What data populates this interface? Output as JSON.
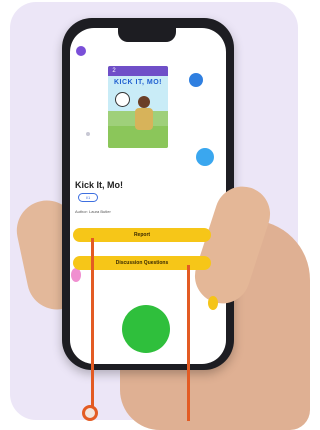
{
  "book": {
    "cover_number": "2",
    "cover_title": "KICK IT, MO!",
    "title": "Kick It, Mo!",
    "level_badge": "I/1",
    "author_line": "Author: Laura Butler"
  },
  "actions": {
    "report_label": "Report",
    "discussion_label": "Discussion Questions"
  },
  "colors": {
    "accent_yellow": "#f6c618",
    "background_lavender": "#ece6f7",
    "marker_orange": "#e35b23",
    "back_button_purple": "#7a4fd8"
  }
}
